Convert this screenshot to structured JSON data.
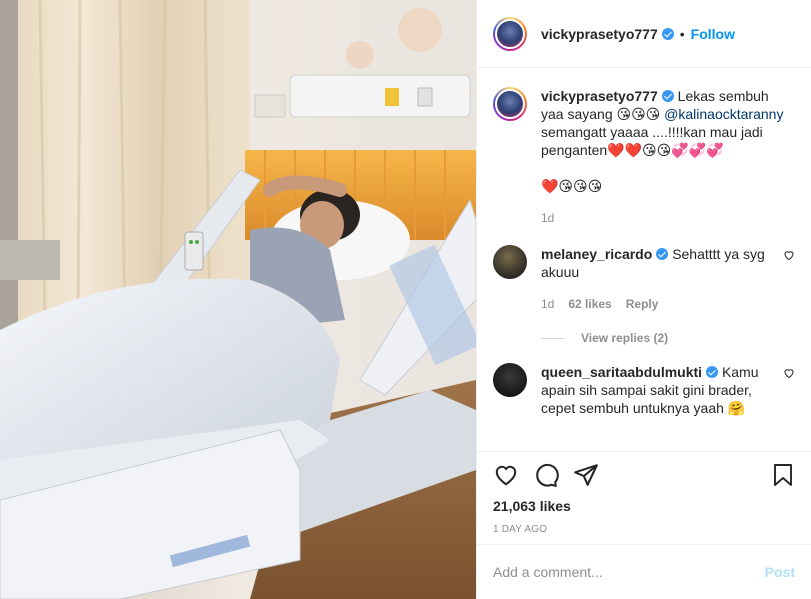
{
  "post": {
    "username": "vickyprasetyo777",
    "follow_label": "Follow",
    "dot": "•"
  },
  "caption": {
    "username": "vickyprasetyo777",
    "text_1": "Lekas sembuh yaa sayang 😘😘😘",
    "mention": "@kalinaocktaranny",
    "text_2": "semangatt yaaaa ....!!!!kan mau jadi penganten❤️❤️😘😘💞💞💞",
    "text_3": "❤️😘😘😘",
    "time": "1d"
  },
  "comments": [
    {
      "username": "melaney_ricardo",
      "text": "Sehatttt ya syg akuuu",
      "time": "1d",
      "likes": "62 likes",
      "reply_label": "Reply",
      "view_replies": "View replies (2)"
    },
    {
      "username": "queen_saritaabdulmukti",
      "text": "Kamu apain sih sampai sakit gini brader, cepet sembuh untuknya yaah 🤗"
    }
  ],
  "actions": {
    "likes": "21,063 likes",
    "posted": "1 DAY AGO"
  },
  "add_comment": {
    "placeholder": "Add a comment...",
    "post_label": "Post"
  },
  "icons": [
    "heart-icon",
    "comment-icon",
    "share-icon",
    "bookmark-icon",
    "verified-icon"
  ],
  "colors": {
    "link_blue": "#0095f6",
    "verified_blue": "#3897f0",
    "post_disabled": "#b2dffc",
    "meta_gray": "#8e8e8e"
  }
}
